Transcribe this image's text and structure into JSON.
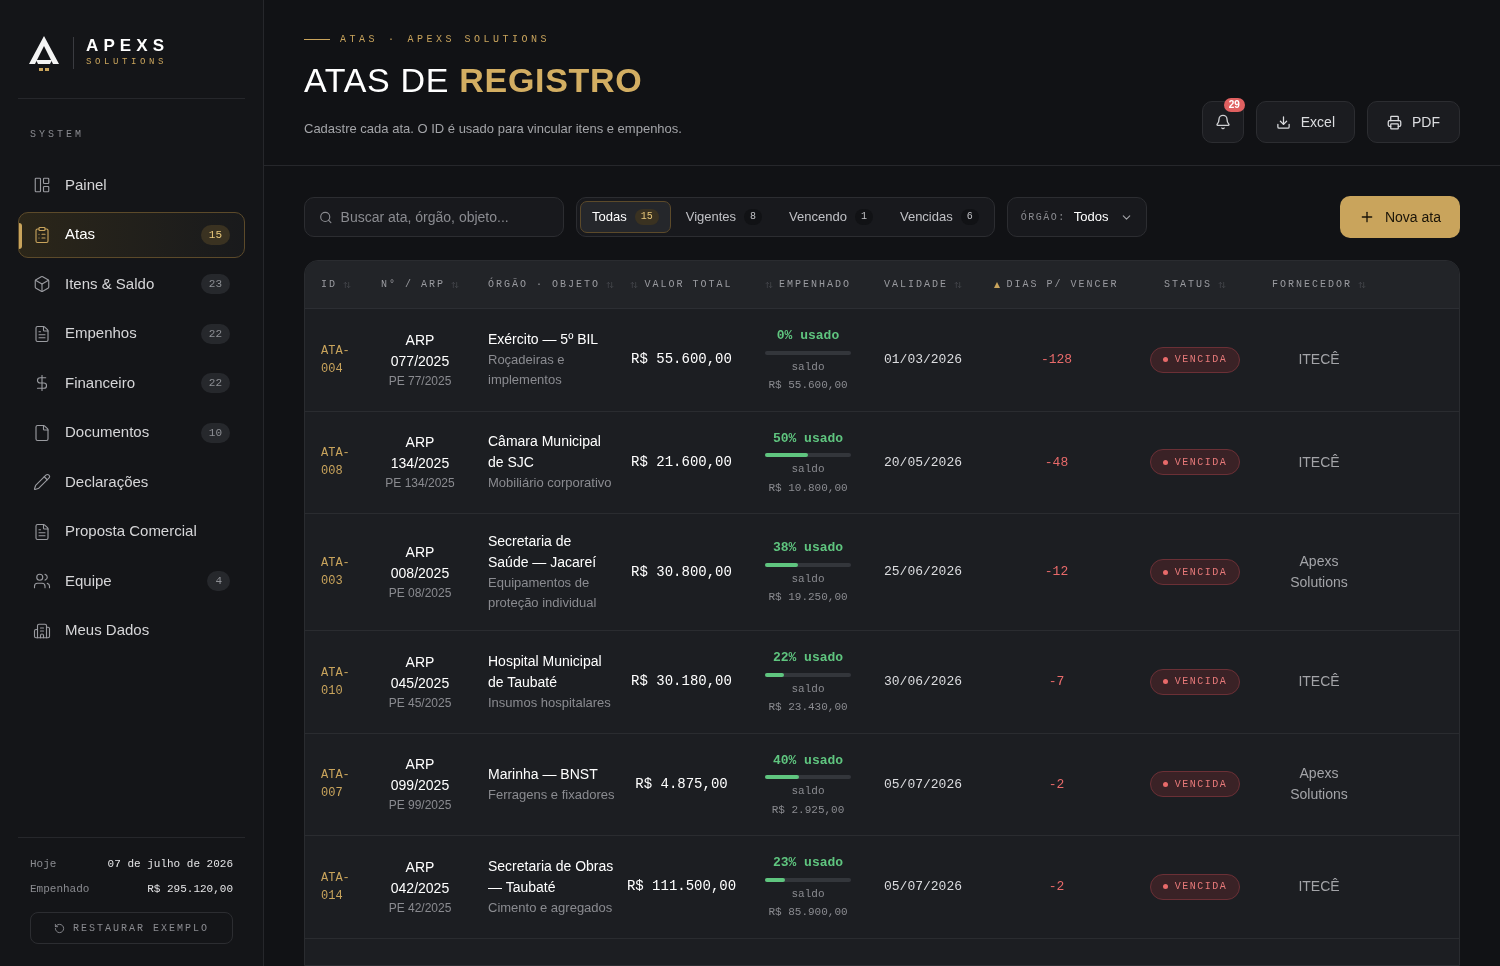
{
  "brand": {
    "name": "APEXS",
    "tagline": "SOLUTIONS"
  },
  "sidebar": {
    "section": "SYSTEM",
    "items": [
      {
        "label": "Painel",
        "selected": false
      },
      {
        "label": "Atas",
        "count": "15",
        "selected": true
      },
      {
        "label": "Itens & Saldo",
        "count": "23",
        "selected": false
      },
      {
        "label": "Empenhos",
        "count": "22",
        "selected": false
      },
      {
        "label": "Financeiro",
        "count": "22",
        "selected": false
      },
      {
        "label": "Documentos",
        "count": "10",
        "selected": false
      },
      {
        "label": "Declarações",
        "selected": false
      },
      {
        "label": "Proposta Comercial",
        "selected": false
      },
      {
        "label": "Equipe",
        "count": "4",
        "selected": false
      },
      {
        "label": "Meus Dados",
        "selected": false
      }
    ],
    "footer": [
      {
        "label": "Hoje",
        "value": "07 de julho de 2026"
      },
      {
        "label": "Empenhado",
        "value": "R$ 295.120,00"
      }
    ],
    "restore_button": "RESTAURAR EXEMPLO"
  },
  "header": {
    "breadcrumb": [
      "ATAS",
      "·",
      "APEXS SOLUTIONS"
    ],
    "title": "ATAS DE",
    "title_highlight": "REGISTRO",
    "subtitle": "Cadastre cada ata. O ID é usado para vincular itens e empenhos.",
    "notifications": "29",
    "buttons": [
      "Excel",
      "PDF"
    ]
  },
  "toolbar": {
    "search": {
      "placeholder": "Buscar ata, órgão, objeto..."
    },
    "filters": [
      {
        "label": "Todas",
        "count": "15",
        "selected": true
      },
      {
        "label": "Vigentes",
        "count": "8",
        "selected": false
      },
      {
        "label": "Vencendo",
        "count": "1",
        "selected": false
      },
      {
        "label": "Vencidas",
        "count": "6",
        "selected": false
      }
    ],
    "orgao": {
      "label": "ÓRGÃO:",
      "value": "Todos"
    },
    "new_button": "Nova ata"
  },
  "table": {
    "columns": [
      {
        "label": "ID",
        "sorted": false
      },
      {
        "label": "N° / ARP",
        "sorted": false
      },
      {
        "label": "ÓRGÃO · OBJETO",
        "sorted": false
      },
      {
        "label": "VALOR TOTAL",
        "sorted": false
      },
      {
        "label": "EMPENHADO",
        "sorted": false
      },
      {
        "label": "VALIDADE",
        "sorted": false
      },
      {
        "label": "DIAS P/ VENCER",
        "sorted": true
      },
      {
        "label": "STATUS",
        "sorted": false
      },
      {
        "label": "FORNECEDOR",
        "sorted": false
      }
    ],
    "rows": [
      {
        "id": "ATA-004",
        "arp": "ARP 077/2025",
        "pe": "PE 77/2025",
        "orgao": "Exército — 5º BIL",
        "objeto": "Roçadeiras e implementos",
        "valor": "R$ 55.600,00",
        "usado": "0% usado",
        "level": 0,
        "saldo_label": "saldo",
        "saldo": "R$ 55.600,00",
        "validade": "01/03/2026",
        "dias": "-128",
        "status": "VENCIDA",
        "kind": "expired",
        "fornecedor": "ITECÊ"
      },
      {
        "id": "ATA-008",
        "arp": "ARP 134/2025",
        "pe": "PE 134/2025",
        "orgao": "Câmara Municipal de SJC",
        "objeto": "Mobiliário corporativo",
        "valor": "R$ 21.600,00",
        "usado": "50% usado",
        "level": 0.5,
        "saldo_label": "saldo",
        "saldo": "R$ 10.800,00",
        "validade": "20/05/2026",
        "dias": "-48",
        "status": "VENCIDA",
        "kind": "expired",
        "fornecedor": "ITECÊ"
      },
      {
        "id": "ATA-003",
        "arp": "ARP 008/2025",
        "pe": "PE 08/2025",
        "orgao": "Secretaria de Saúde — Jacareí",
        "objeto": "Equipamentos de proteção individual",
        "valor": "R$ 30.800,00",
        "usado": "38% usado",
        "level": 0.38,
        "saldo_label": "saldo",
        "saldo": "R$ 19.250,00",
        "validade": "25/06/2026",
        "dias": "-12",
        "status": "VENCIDA",
        "kind": "expired",
        "fornecedor": "Apexs Solutions"
      },
      {
        "id": "ATA-010",
        "arp": "ARP 045/2025",
        "pe": "PE 45/2025",
        "orgao": "Hospital Municipal de Taubaté",
        "objeto": "Insumos hospitalares",
        "valor": "R$ 30.180,00",
        "usado": "22% usado",
        "level": 0.22,
        "saldo_label": "saldo",
        "saldo": "R$ 23.430,00",
        "validade": "30/06/2026",
        "dias": "-7",
        "status": "VENCIDA",
        "kind": "expired",
        "fornecedor": "ITECÊ"
      },
      {
        "id": "ATA-007",
        "arp": "ARP 099/2025",
        "pe": "PE 99/2025",
        "orgao": "Marinha — BNST",
        "objeto": "Ferragens e fixadores",
        "valor": "R$ 4.875,00",
        "usado": "40% usado",
        "level": 0.4,
        "saldo_label": "saldo",
        "saldo": "R$ 2.925,00",
        "validade": "05/07/2026",
        "dias": "-2",
        "status": "VENCIDA",
        "kind": "expired",
        "fornecedor": "Apexs Solutions"
      },
      {
        "id": "ATA-014",
        "arp": "ARP 042/2025",
        "pe": "PE 42/2025",
        "orgao": "Secretaria de Obras — Taubaté",
        "objeto": "Cimento e agregados",
        "valor": "R$ 111.500,00",
        "usado": "23% usado",
        "level": 0.23,
        "saldo_label": "saldo",
        "saldo": "R$ 85.900,00",
        "validade": "05/07/2026",
        "dias": "-2",
        "status": "VENCIDA",
        "kind": "expired",
        "fornecedor": "ITECÊ"
      }
    ]
  }
}
